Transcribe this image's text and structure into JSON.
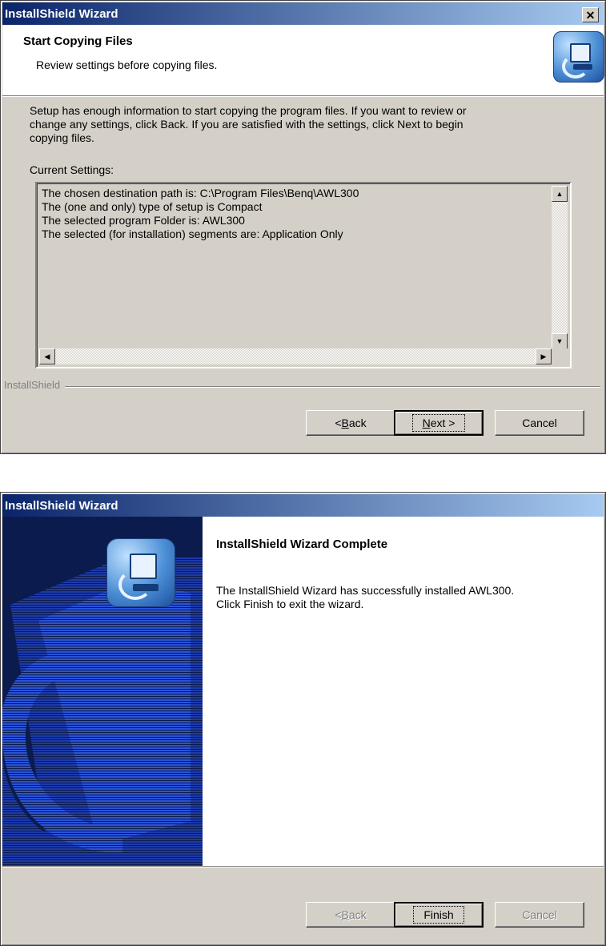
{
  "window1": {
    "title": "InstallShield Wizard",
    "close_label": "✕",
    "header_title": "Start Copying Files",
    "header_subtitle": "Review settings before copying files.",
    "body_lines": [
      "Setup has enough information to start copying the program files.  If you want to review or",
      "change any settings, click Back.  If you are satisfied with the settings, click Next to begin",
      "copying files."
    ],
    "current_settings_label": "Current Settings:",
    "settings_lines": [
      "The chosen destination path is: C:\\Program Files\\Benq\\AWL300",
      "The (one and only) type of setup is Compact",
      "The selected program Folder is: AWL300",
      "The selected (for installation) segments are: Application Only"
    ],
    "brand_label": "InstallShield",
    "buttons": {
      "back_prefix": "< ",
      "back_hotkey": "B",
      "back_rest": "ack",
      "next_hotkey": "N",
      "next_rest": "ext >",
      "cancel": "Cancel"
    }
  },
  "window2": {
    "title": "InstallShield Wizard",
    "complete_title": "InstallShield Wizard Complete",
    "complete_lines": [
      "The InstallShield Wizard has successfully installed AWL300.",
      "Click Finish to exit the wizard."
    ],
    "buttons": {
      "back_prefix": "< ",
      "back_hotkey": "B",
      "back_rest": "ack",
      "finish": "Finish",
      "cancel": "Cancel"
    }
  },
  "colors": {
    "titlebar_start": "#0a246a",
    "titlebar_end": "#a6caf0",
    "dialog_face": "#d4d0c8",
    "side_panel": "#0c1b4e"
  },
  "icons": [
    "installshield-logo-icon",
    "close-icon",
    "scroll-up-icon",
    "scroll-down-icon",
    "scroll-left-icon",
    "scroll-right-icon"
  ]
}
